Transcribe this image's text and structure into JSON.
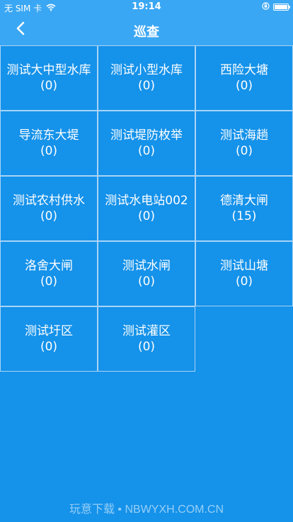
{
  "status_bar": {
    "carrier": "无 SIM 卡",
    "time": "19:14"
  },
  "nav": {
    "title": "巡查",
    "back_icon": "chevron-left-icon"
  },
  "items": [
    {
      "name": "测试大中型水库",
      "count": "(0)"
    },
    {
      "name": "测试小型水库",
      "count": "(0)"
    },
    {
      "name": "西险大塘",
      "count": "(0)"
    },
    {
      "name": "导流东大堤",
      "count": "(0)"
    },
    {
      "name": "测试堤防枚举",
      "count": "(0)"
    },
    {
      "name": "测试海趟",
      "count": "(0)"
    },
    {
      "name": "测试农村供水",
      "count": "(0)"
    },
    {
      "name": "测试水电站002",
      "count": "(0)"
    },
    {
      "name": "德清大闸",
      "count": "(15)"
    },
    {
      "name": "洛舍大闸",
      "count": "(0)"
    },
    {
      "name": "测试水闸",
      "count": "(0)"
    },
    {
      "name": "测试山塘",
      "count": "(0)"
    },
    {
      "name": "测试圩区",
      "count": "(0)"
    },
    {
      "name": "测试灌区",
      "count": "(0)"
    }
  ],
  "watermark": "玩意下载 • NBWYXH.COM.CN",
  "colors": {
    "background": "#1592ea",
    "nav_bar": "#3aa7f4",
    "grid_line": "#a9d4f6"
  }
}
